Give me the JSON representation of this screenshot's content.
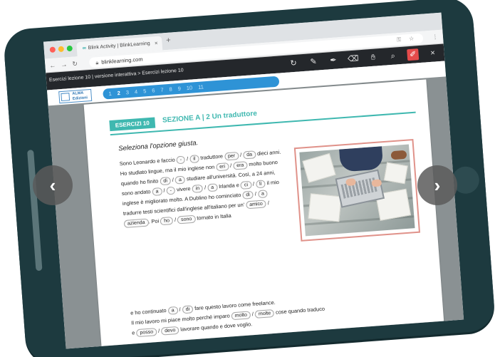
{
  "browser": {
    "tab_title": "Blink Activity | BlinkLearning",
    "tab_favicon": "∞",
    "new_tab": "+",
    "url": "blinklearning.com"
  },
  "toolbar": {
    "breadcrumb": "Esercizi lezione 10 | versione interattiva > Esercizi lezione 10",
    "icons": [
      "refresh-icon",
      "pencil-icon",
      "marker-icon",
      "eraser-icon",
      "hand-icon",
      "search-icon",
      "pen-icon",
      "close-icon"
    ]
  },
  "brand": {
    "logo_line1": "ALMA",
    "logo_line2": "Edizioni",
    "pages": [
      "1",
      "2",
      "3",
      "4",
      "5",
      "6",
      "7",
      "8",
      "9",
      "10",
      "11"
    ],
    "current_page": "2"
  },
  "exercise": {
    "badge": "ESERCIZI 10",
    "section": "SEZIONE A | 2 Un traduttore",
    "instruction": "Seleziona l'opzione giusta.",
    "t1": "Sono Leonardo e faccio",
    "o1a": "-",
    "s1": "/",
    "o1b": "il",
    "t2": "traduttore",
    "o2a": "per",
    "s2": "/",
    "o2b": "da",
    "t3": "dieci anni. Ho studiato lingue, ma il mio inglese non",
    "o3a": "eri",
    "s3": "/",
    "o3b": "era",
    "t4": "molto buono quando ho finito",
    "o4a": "di",
    "s4": "/",
    "o4b": "a",
    "t5": "studiare all'università. Così, a 24 anni, sono andato",
    "o5a": "a",
    "s5": "/",
    "o5b": "-",
    "t6": "vivere",
    "o6a": "in",
    "s6": "/",
    "o6b": "a",
    "t7": "Irlanda e",
    "o7a": "ci",
    "s7": "/",
    "o7b": "lì",
    "t8": "il mio inglese è migliorato molto. A Dublino ho cominciato",
    "o8a": "di",
    "s8": "/",
    "o8b": "a",
    "t9": "tradurre testi scientifici dall'inglese all'italiano per un'",
    "o9a": "amico",
    "s9": "/",
    "o9b": "azienda",
    "t10": ". Poi",
    "o10a": "ho",
    "s10": "/",
    "o10b": "sono",
    "t11": "tornato in Italia",
    "t12": "e ho continuato",
    "o12a": "a",
    "s12": "/",
    "o12b": "di",
    "t13": "fare questo lavoro come freelance.",
    "t14": "Il mio lavoro mi piace molto perché imparo",
    "o14a": "molto",
    "s14": "/",
    "o14b": "molte",
    "t15": "cose quando traduco",
    "t16": "e",
    "o16a": "posso",
    "s16": "/",
    "o16b": "devo",
    "t17": "lavorare quando e dove voglio."
  },
  "nav": {
    "prev": "‹",
    "next": "›"
  },
  "colors": {
    "teal": "#3fb8b0",
    "pager_blue": "#2e93d6",
    "frame": "#1d3a3f",
    "toolbar": "#24272b"
  }
}
